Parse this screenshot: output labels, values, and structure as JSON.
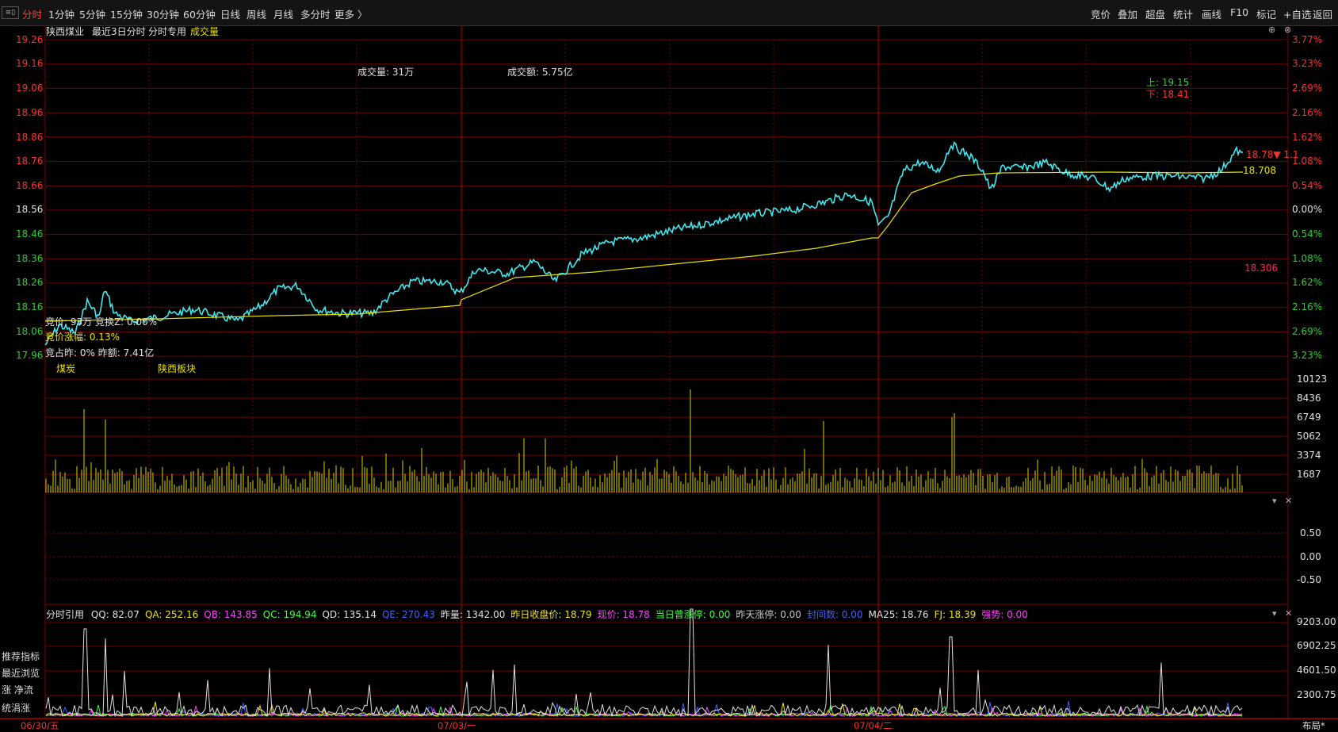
{
  "toolbar": {
    "left_items": [
      "分时",
      "1分钟",
      "5分钟",
      "15分钟",
      "30分钟",
      "60分钟",
      "日线",
      "周线",
      "月线",
      "多分时",
      "更多 〉"
    ],
    "active": "分时",
    "right_items": [
      "竞价",
      "叠加",
      "超盘",
      "统计",
      "画线",
      "F10",
      "标记",
      "+自选",
      "返回"
    ]
  },
  "header": {
    "stock_name": "陕西煤业",
    "mode": "最近3日分时",
    "template": "分时专用",
    "indicator": "成交量"
  },
  "price_panel": {
    "volume_label": "成交量: 31万",
    "amount_label": "成交额: 5.75亿",
    "upper_label": "上: 19.15",
    "lower_label": "下: 18.41",
    "current_tag": "18.78▼ 1.1",
    "avg_tag": "18.708",
    "ref_tag": "18.306",
    "auction_line1": "竞价: 93万 竞换Z: 0.00%",
    "auction_line2": "竞价涨幅: 0.13%",
    "auction_line3": "竞占昨: 0%  昨额: 7.41亿",
    "sector1": "煤炭",
    "sector2": "陕西板块"
  },
  "left_price_axis": [
    "19.26",
    "19.16",
    "19.06",
    "18.96",
    "18.86",
    "18.76",
    "18.66",
    "18.56",
    "18.46",
    "18.36",
    "18.26",
    "18.16",
    "18.06",
    "17.96"
  ],
  "right_pct_axis": [
    "3.77%",
    "3.23%",
    "2.69%",
    "2.16%",
    "1.62%",
    "1.08%",
    "0.54%",
    "0.00%",
    "0.54%",
    "1.08%",
    "1.62%",
    "2.16%",
    "2.69%",
    "3.23%"
  ],
  "volume_axis": [
    "10123",
    "8436",
    "6749",
    "5062",
    "3374",
    "1687"
  ],
  "mid_axis": [
    "0.50",
    "0.00",
    "-0.50"
  ],
  "indicator_bar": {
    "name": "分时引用",
    "items": [
      {
        "label": "QQ: 82.07",
        "color": "#e0e0e0"
      },
      {
        "label": "QA: 252.16",
        "color": "#f0e020"
      },
      {
        "label": "QB: 143.85",
        "color": "#ff40ff"
      },
      {
        "label": "QC: 194.94",
        "color": "#40ff40"
      },
      {
        "label": "QD: 135.14",
        "color": "#e0e0e0"
      },
      {
        "label": "QE: 270.43",
        "color": "#4060ff"
      },
      {
        "label": "昨量: 1342.00",
        "color": "#e0e0e0"
      },
      {
        "label": "昨日收盘价: 18.79",
        "color": "#f0e020"
      },
      {
        "label": "现价: 18.78",
        "color": "#ff40ff"
      },
      {
        "label": "当日曾涨停: 0.00",
        "color": "#40ff40"
      },
      {
        "label": "昨天涨停: 0.00",
        "color": "#c8c8c8"
      },
      {
        "label": "封间数: 0.00",
        "color": "#4060ff"
      },
      {
        "label": "MA25: 18.76",
        "color": "#e0e0e0"
      },
      {
        "label": "FJ: 18.39",
        "color": "#f0e020"
      },
      {
        "label": "强势: 0.00",
        "color": "#ff40ff"
      }
    ]
  },
  "bottom_axis": [
    "9203.00",
    "6902.25",
    "4601.50",
    "2300.75"
  ],
  "left_side_labels": [
    "推荐指标",
    "最近浏览",
    "涨  净流",
    "统涓涨"
  ],
  "date_axis": [
    "06/30/五",
    "07/03/一",
    "07/04/二"
  ],
  "layout_button": "布局*",
  "colors": {
    "grid": "#7a0000",
    "price_line": "#40e8f0",
    "avg_line": "#e8e000",
    "up": "#ff3030",
    "down": "#30d030",
    "volume": "#b8b000"
  }
}
